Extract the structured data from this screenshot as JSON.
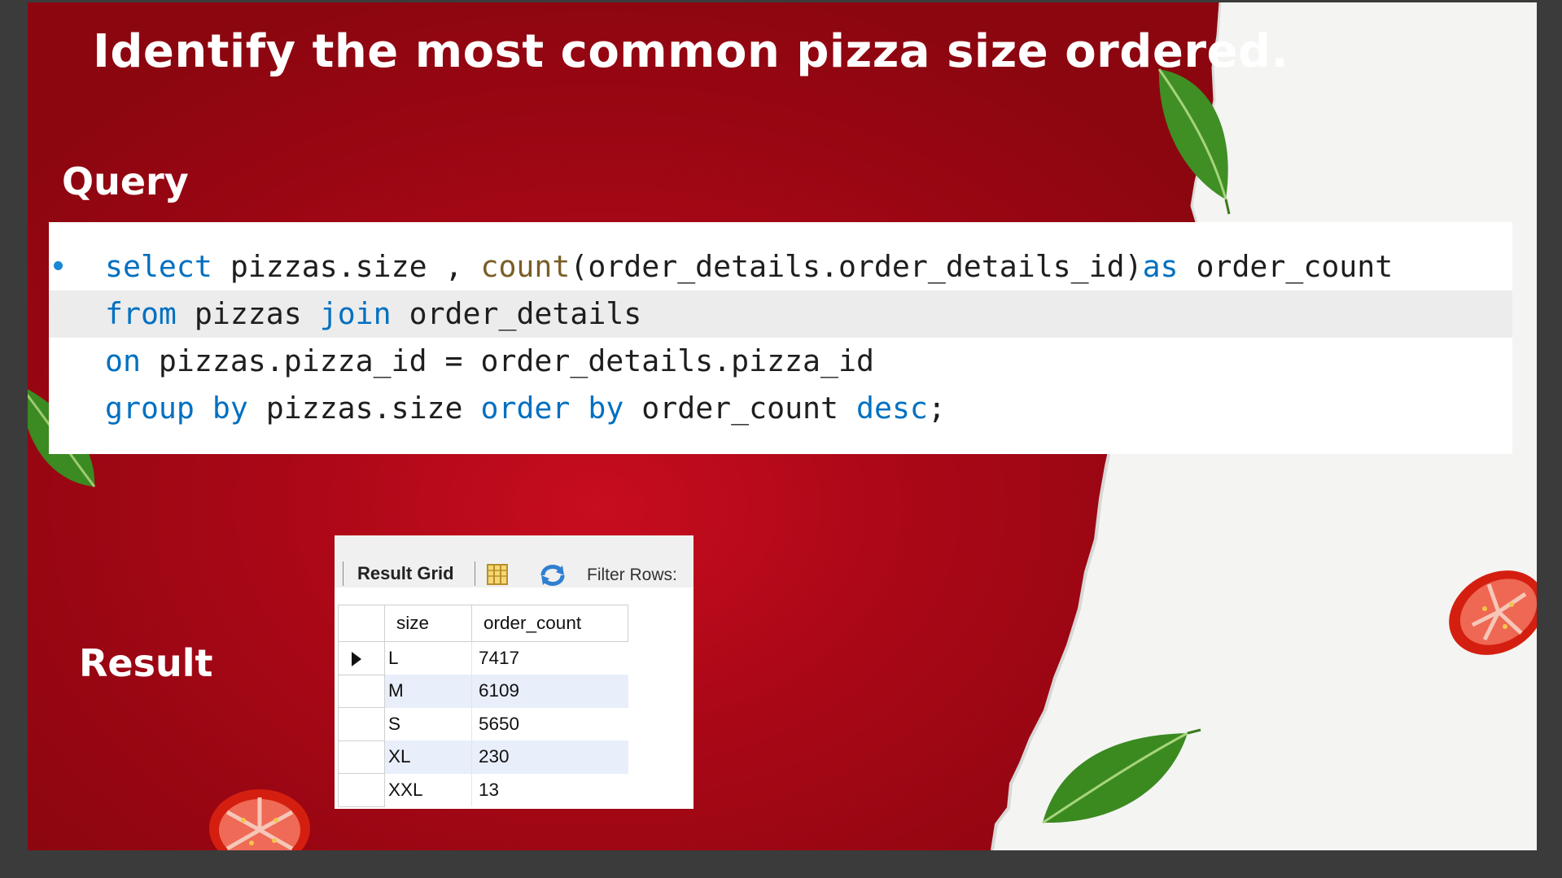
{
  "title": "Identify the most common pizza size ordered.",
  "query_label": "Query",
  "result_label": "Result",
  "code": {
    "line1": [
      {
        "t": "select",
        "c": "kw"
      },
      {
        "t": " pizzas.size , ",
        "c": ""
      },
      {
        "t": "count",
        "c": "fn"
      },
      {
        "t": "(order_details.order_details_id)",
        "c": ""
      },
      {
        "t": "as",
        "c": "kw"
      },
      {
        "t": " order_count",
        "c": ""
      }
    ],
    "line2": [
      {
        "t": "from",
        "c": "kw"
      },
      {
        "t": " pizzas ",
        "c": ""
      },
      {
        "t": "join",
        "c": "kw"
      },
      {
        "t": " order_details",
        "c": ""
      }
    ],
    "line3": [
      {
        "t": "on",
        "c": "kw"
      },
      {
        "t": " pizzas.pizza_id = order_details.pizza_id",
        "c": ""
      }
    ],
    "line4": [
      {
        "t": "group by",
        "c": "kw"
      },
      {
        "t": " pizzas.size ",
        "c": ""
      },
      {
        "t": "order by",
        "c": "kw"
      },
      {
        "t": " order_count ",
        "c": ""
      },
      {
        "t": "desc",
        "c": "kw"
      },
      {
        "t": ";",
        "c": ""
      }
    ]
  },
  "result_grid": {
    "toolbar_label": "Result Grid",
    "filter_label": "Filter Rows:",
    "columns": [
      "size",
      "order_count"
    ],
    "rows": [
      {
        "size": "L",
        "order_count": "7417"
      },
      {
        "size": "M",
        "order_count": "6109"
      },
      {
        "size": "S",
        "order_count": "5650"
      },
      {
        "size": "XL",
        "order_count": "230"
      },
      {
        "size": "XXL",
        "order_count": "13"
      }
    ]
  },
  "colors": {
    "background_red": "#a90716",
    "keyword_blue": "#0070c1",
    "function_brown": "#795e26",
    "selected_row": "#e8eefa"
  },
  "icons": [
    "basil-leaf",
    "tomato-slice",
    "columns-icon",
    "refresh-icon",
    "row-pointer-icon"
  ]
}
